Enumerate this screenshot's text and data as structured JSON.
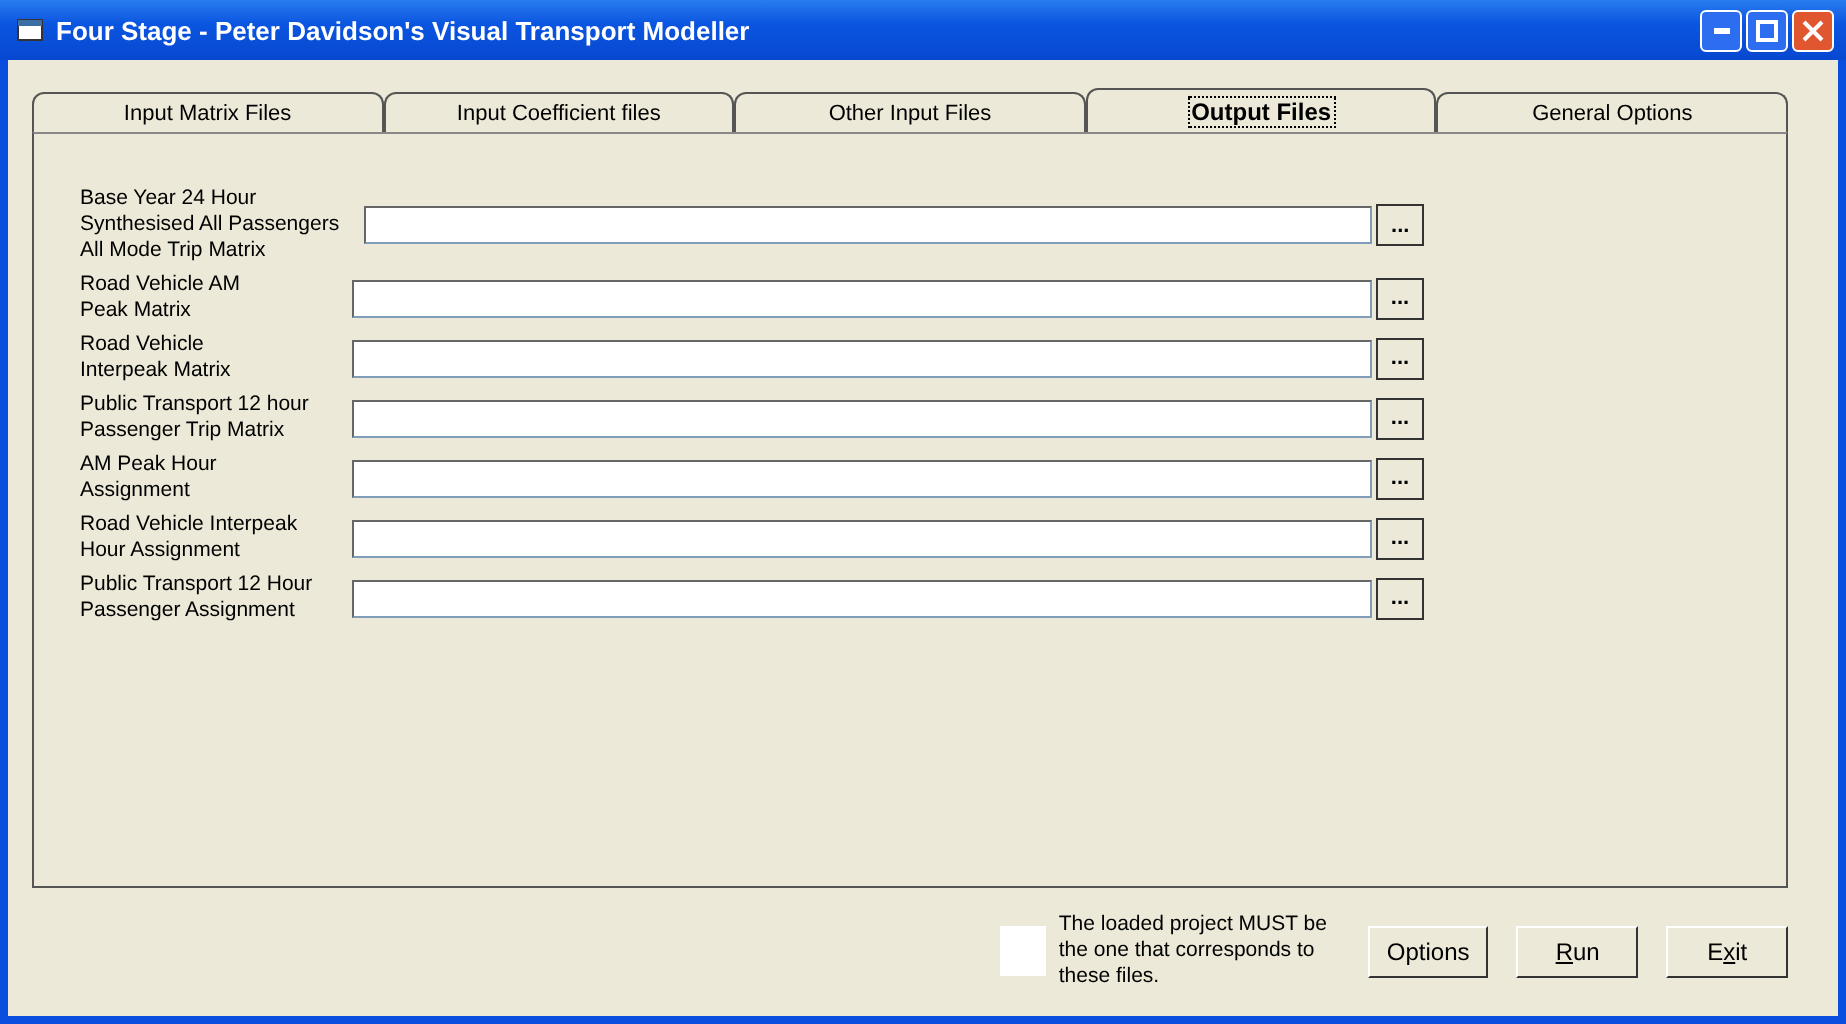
{
  "window": {
    "title": "Four Stage - Peter Davidson's Visual Transport Modeller"
  },
  "tabs": [
    {
      "label": "Input Matrix Files",
      "selected": false
    },
    {
      "label": "Input Coefficient files",
      "selected": false
    },
    {
      "label": "Other Input Files",
      "selected": false
    },
    {
      "label": "Output Files",
      "selected": true
    },
    {
      "label": "General Options",
      "selected": false
    }
  ],
  "files": [
    {
      "label": "Base Year 24 Hour Synthesised All Passengers All Mode Trip Matrix",
      "browse": "..."
    },
    {
      "label": "Road Vehicle AM Peak Matrix",
      "browse": "..."
    },
    {
      "label": "Road Vehicle Interpeak Matrix",
      "browse": "..."
    },
    {
      "label": "Public Transport 12 hour Passenger Trip Matrix",
      "browse": "..."
    },
    {
      "label": "AM Peak Hour Assignment",
      "browse": "..."
    },
    {
      "label": "Road Vehicle Interpeak Hour Assignment",
      "browse": "..."
    },
    {
      "label": "Public Transport 12 Hour Passenger Assignment",
      "browse": "..."
    }
  ],
  "note": "The loaded project MUST be the one that corresponds to these files.",
  "buttons": [
    {
      "label": "Options"
    },
    {
      "mnemonic": "R",
      "after": "un"
    },
    {
      "before": "E",
      "mnemonic": "x",
      "after": "it"
    }
  ]
}
